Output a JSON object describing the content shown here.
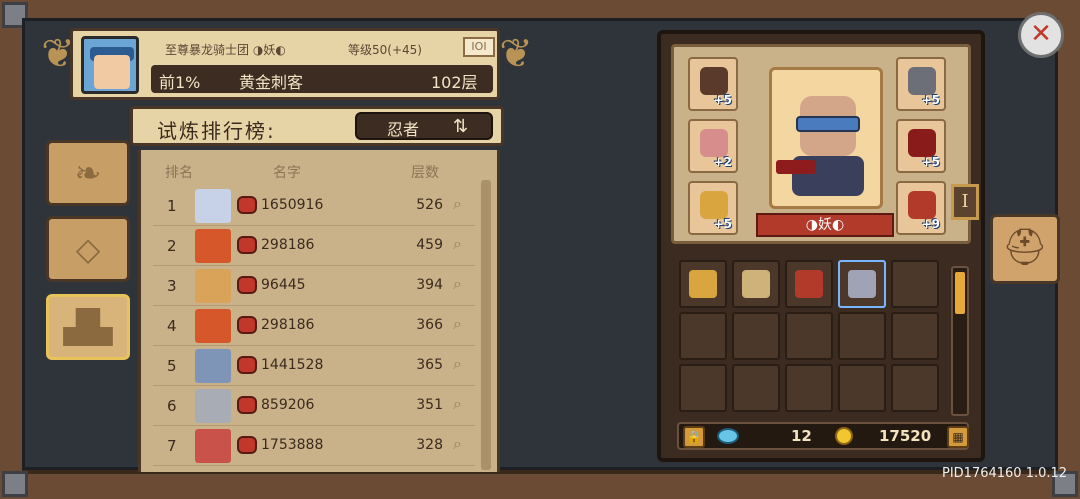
{
  "player": {
    "guild": "至尊暴龙骑士团",
    "pet_status": "◑妖◐",
    "level_text": "等级50(+45)",
    "badge_text": "IOI",
    "percentile": "前1%",
    "title": "黄金刺客",
    "floors": "102层"
  },
  "leaderboard": {
    "title": "试炼排行榜:",
    "class_filter": "忍者",
    "swap_icon": "⇅",
    "col_rank": "排名",
    "col_name": "名字",
    "col_floors": "层数",
    "rows": [
      {
        "rank": "1",
        "id": "1650916",
        "floors": "526",
        "color": "#c7d2e8"
      },
      {
        "rank": "2",
        "id": "298186",
        "floors": "459",
        "color": "#d6582a"
      },
      {
        "rank": "3",
        "id": "96445",
        "floors": "394",
        "color": "#d9a35a"
      },
      {
        "rank": "4",
        "id": "298186",
        "floors": "366",
        "color": "#d6582a"
      },
      {
        "rank": "5",
        "id": "1441528",
        "floors": "365",
        "color": "#7f95b8"
      },
      {
        "rank": "6",
        "id": "859206",
        "floors": "351",
        "color": "#a8acb5"
      },
      {
        "rank": "7",
        "id": "1753888",
        "floors": "328",
        "color": "#c9534a"
      }
    ]
  },
  "equipment": {
    "banner": "◑妖◐",
    "tier": "I",
    "slots": [
      {
        "plus": "+5",
        "color": "#5a3a2a"
      },
      {
        "plus": "+2",
        "color": "#d88d8d"
      },
      {
        "plus": "+5",
        "color": "#d9a53e"
      },
      {
        "plus": "+5",
        "color": "#6d6f78"
      },
      {
        "plus": "+5",
        "color": "#8a1b1b"
      },
      {
        "plus": "+9",
        "color": "#b23a2b"
      }
    ],
    "inventory_colors": [
      "#d9a53e",
      "#cfb27a",
      "#b23a2b",
      "#9fa3b5"
    ],
    "gems": "12",
    "coins": "17520"
  },
  "footer": {
    "pid": "PID1764160 1.0.12"
  }
}
